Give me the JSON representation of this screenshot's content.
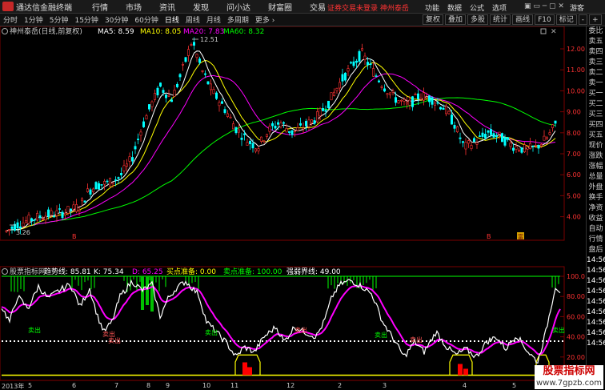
{
  "menubar": {
    "app_title": "通达信金融终端",
    "items": [
      "行情",
      "市场",
      "资讯",
      "发现",
      "问小达",
      "财富圈",
      "交易"
    ],
    "notice": "证券交易未登录  神州泰岳",
    "right_items": [
      "功能",
      "数据",
      "公式",
      "选项"
    ],
    "window_icons": "▣ ▭ ─ ▢ ✕",
    "guest": "游客"
  },
  "periodbar": {
    "tabs": [
      "分时",
      "1分钟",
      "5分钟",
      "15分钟",
      "30分钟",
      "60分钟",
      "日线",
      "周线",
      "月线",
      "多周期",
      "更多 ›"
    ],
    "active_tab": "日线",
    "tools": [
      "复权",
      "叠加",
      "多股",
      "统计",
      "画线",
      "F10",
      "标记",
      "-",
      "+"
    ]
  },
  "main_header": {
    "title": "神州泰岳(日线,前复权)",
    "ma5": "MA5: 8.59",
    "ma10": "MA10: 8.05",
    "ma20": "MA20: 7.83",
    "ma60": "MA60: 8.32"
  },
  "price_axis": [
    "12.00",
    "11.00",
    "10.00",
    "9.00",
    "8.00",
    "7.00",
    "6.00",
    "5.00",
    "4.00"
  ],
  "annotations": {
    "high": "12.51",
    "low": "3.26",
    "markers": [
      "B",
      "B",
      "富"
    ]
  },
  "indicator_header": {
    "title": "股票指标网",
    "trend": "趋势线: 85.81",
    "k": "K: 75.34",
    "d": "D: 65.25",
    "buy_ready": "买点准备: 0.00",
    "sell_ready": "卖点准备: 100.00",
    "strength": "强弱界线: 49.00"
  },
  "indicator_axis": [
    "100.0",
    "80.00",
    "60.00",
    "40.00",
    "20.00"
  ],
  "indicator_labels": [
    "卖出",
    "卖出",
    "卖出",
    "卖出",
    "卖出",
    "卖出",
    "卖出",
    "卖出"
  ],
  "sidebar_tabs": [
    "委比",
    "卖五",
    "卖四",
    "卖三",
    "卖二",
    "卖一",
    "买一",
    "买二",
    "买三",
    "买四",
    "买五",
    "现价",
    "涨跌",
    "涨幅",
    "总量",
    "外盘",
    "换手",
    "净资",
    "收益",
    "自动",
    "行情",
    "盘后",
    "14:56",
    "14:56",
    "14:56",
    "14:56",
    "14:56",
    "14:56",
    "14:56",
    "14:56",
    "14:56"
  ],
  "date_axis": [
    "2013年",
    "5",
    "6",
    "7",
    "8",
    "9",
    "10",
    "11",
    "12",
    "2",
    "3",
    "4",
    "5"
  ],
  "watermark": {
    "title": "股票指标网",
    "url": "www.7gpzb.com"
  },
  "colors": {
    "up": "#ff3232",
    "down": "#00ffff",
    "ma5": "#ffffff",
    "ma10": "#ffff00",
    "ma20": "#ff00ff",
    "ma60": "#00ff00",
    "k_line": "#ffffff",
    "d_line": "#ff00ff",
    "midline": "#ffffff"
  }
}
